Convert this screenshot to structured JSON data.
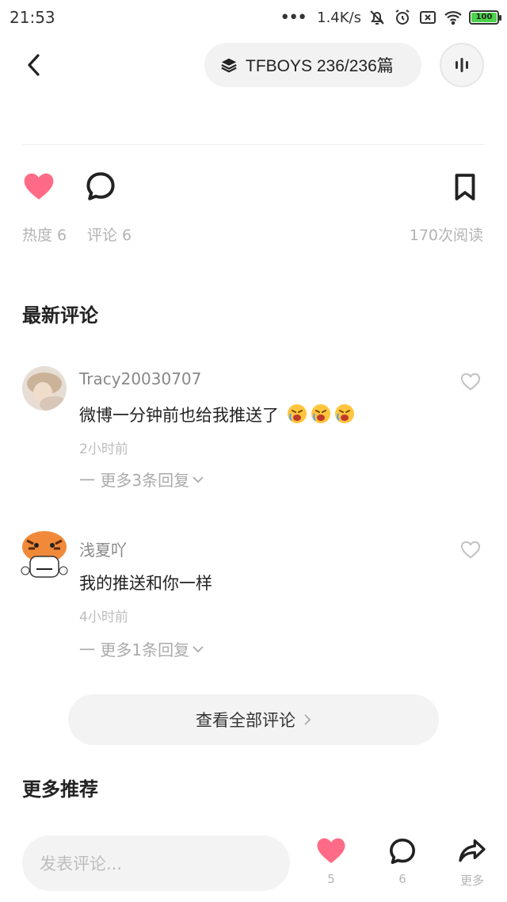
{
  "status_bar": {
    "time": "21:53",
    "network_speed": "1.4K/s",
    "battery": "100"
  },
  "header": {
    "collection_title": "TFBOYS  236/236篇"
  },
  "actions": {
    "heat_label": "热度 6",
    "comments_label": "评论 6",
    "reads_label": "170次阅读"
  },
  "sections": {
    "latest_comments": "最新评论",
    "more_recommend": "更多推荐"
  },
  "comments": [
    {
      "user": "Tracy20030707",
      "text": "微博一分钟前也给我推送了",
      "time": "2小时前",
      "replies": "一 更多3条回复"
    },
    {
      "user": "浅夏吖",
      "text": "我的推送和你一样",
      "time": "4小时前",
      "replies": "一 更多1条回复"
    }
  ],
  "view_all": "查看全部评论",
  "bottom_bar": {
    "input_placeholder": "发表评论...",
    "like_count": "5",
    "comment_count": "6",
    "more_label": "更多"
  },
  "colors": {
    "heart": "#ff6b86",
    "pill_bg": "#f2f2f2",
    "muted_text": "#b3b3b3"
  }
}
